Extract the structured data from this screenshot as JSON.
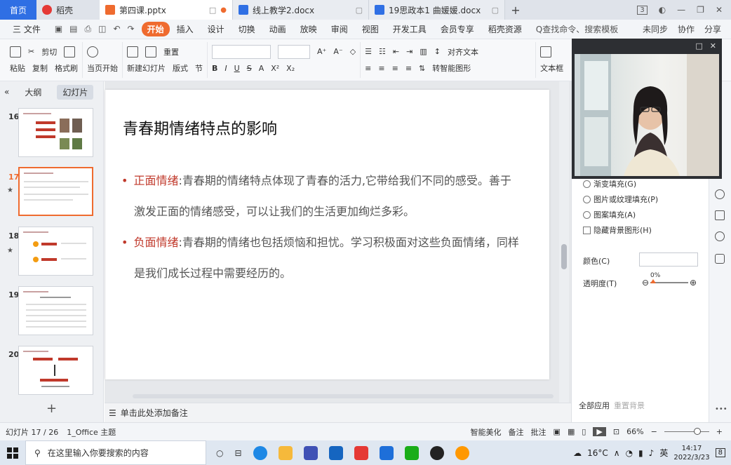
{
  "tabs": [
    {
      "label": "首页",
      "kind": "home"
    },
    {
      "label": "稻壳",
      "kind": "app"
    },
    {
      "label": "第四课.pptx",
      "kind": "doc",
      "active": true
    },
    {
      "label": "线上教学2.docx",
      "kind": "doc"
    },
    {
      "label": "19思政本1 曲媛媛.docx",
      "kind": "doc"
    }
  ],
  "tab_plus": "+",
  "window_badge": "3",
  "menu": {
    "file": "三 文件",
    "items": [
      "开始",
      "插入",
      "设计",
      "切换",
      "动画",
      "放映",
      "审阅",
      "视图",
      "开发工具",
      "会员专享",
      "稻壳资源"
    ],
    "active_index": 0,
    "search": "Q查找命令、搜索模板",
    "right": [
      "未同步",
      "协作",
      "分享"
    ]
  },
  "ribbon": {
    "paste": "粘贴",
    "cut": "剪切",
    "copy": "复制",
    "format_painter": "格式刷",
    "from_current": "当页开始",
    "new_slide": "新建幻灯片",
    "layout": "版式",
    "section": "节",
    "reset": "重置",
    "text_box": "文本框",
    "align_text": "对齐文本",
    "smart_shape": "转智能图形"
  },
  "left_panel": {
    "tab_outline": "大纲",
    "tab_slides": "幻灯片",
    "slides": [
      "16",
      "17",
      "18",
      "19",
      "20"
    ],
    "selected": "17"
  },
  "slide": {
    "title": "青春期情绪特点的影响",
    "bullets": [
      {
        "keyword": "正面情绪",
        "text": ":青春期的情绪特点体现了青春的活力,它带给我们不同的感受。善于",
        "cont": "激发正面的情绪感受，可以让我们的生活更加绚烂多彩。"
      },
      {
        "keyword": "负面情绪",
        "text": ":青春期的情绪也包括烦恼和担忧。学习积极面对这些负面情绪，同样",
        "cont": "是我们成长过程中需要经历的。"
      }
    ]
  },
  "notes_placeholder": "单击此处添加备注",
  "right_panel": {
    "options": [
      "渐变填充(G)",
      "图片或纹理填充(P)",
      "图案填充(A)"
    ],
    "hide_bg": "隐藏背景图形(H)",
    "color_label": "颜色(C)",
    "transparency_label": "透明度(T)",
    "transparency_value": "0%",
    "transparency": 0,
    "apply_all": "全部应用",
    "reset_bg": "重置背景"
  },
  "status": {
    "slide_info": "幻灯片 17 / 26",
    "theme": "1_Office 主题",
    "beautify": "智能美化",
    "notes": "备注",
    "comments": "批注",
    "zoom": "66%"
  },
  "taskbar": {
    "search_placeholder": "在这里输入你要搜索的内容",
    "weather": "16°C",
    "ime": "英",
    "time": "14:17",
    "date": "2022/3/23",
    "notif_count": "8"
  },
  "colors": {
    "accent": "#ef6b2f",
    "home_tab": "#2f6fe4",
    "keyword_red": "#c0392b"
  }
}
